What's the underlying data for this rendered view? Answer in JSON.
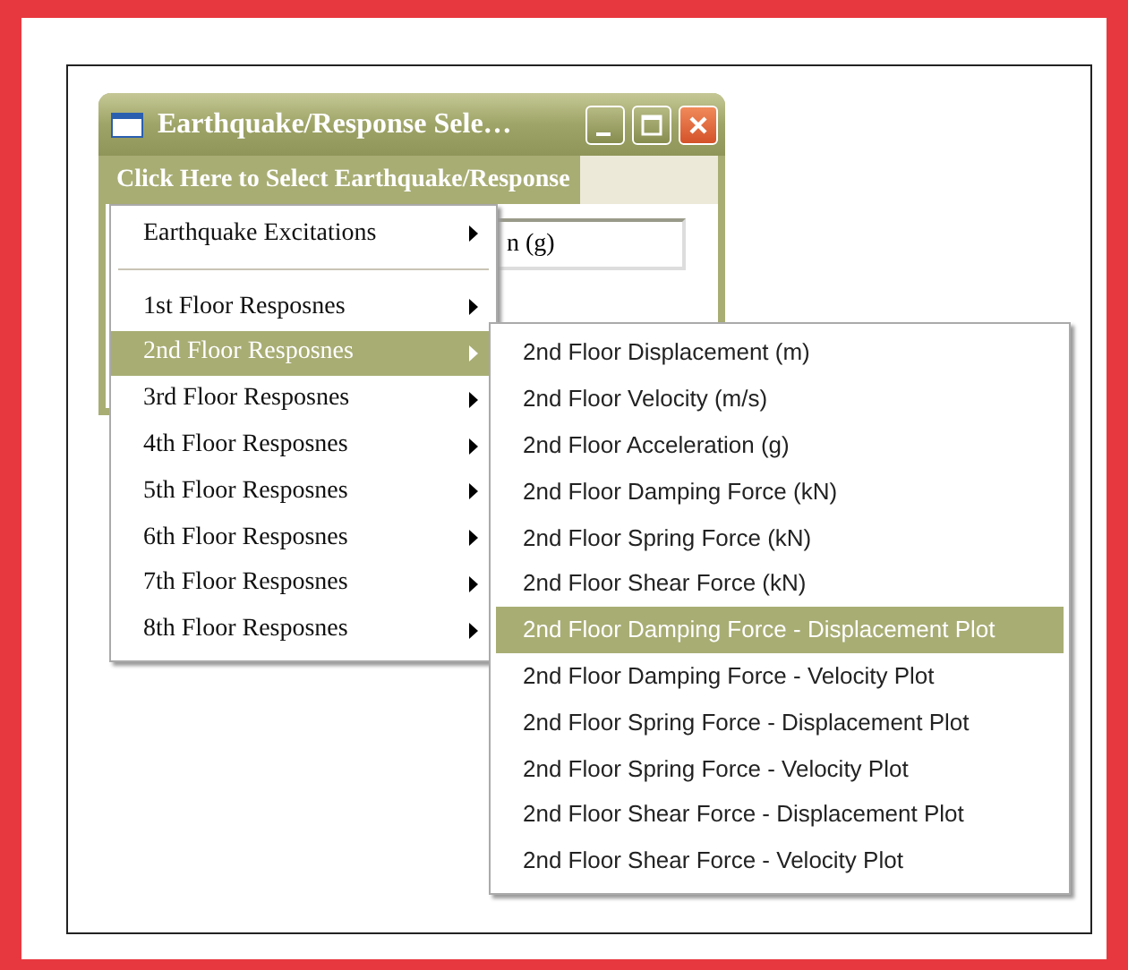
{
  "window": {
    "title": "Earthquake/Response Sele…",
    "menu_bar": "Click Here to Select Earthquake/Response",
    "field_value": "n (g)"
  },
  "menu": {
    "items": [
      {
        "kind": "item",
        "label": "Earthquake Excitations",
        "selected": false
      },
      {
        "kind": "separator"
      },
      {
        "kind": "item",
        "label": "1st Floor Resposnes",
        "selected": false
      },
      {
        "kind": "item",
        "label": "2nd Floor Resposnes",
        "selected": true
      },
      {
        "kind": "item",
        "label": "3rd Floor Resposnes",
        "selected": false
      },
      {
        "kind": "item",
        "label": "4th Floor Resposnes",
        "selected": false
      },
      {
        "kind": "item",
        "label": "5th Floor Resposnes",
        "selected": false
      },
      {
        "kind": "item",
        "label": "6th Floor Resposnes",
        "selected": false
      },
      {
        "kind": "item",
        "label": "7th Floor Resposnes",
        "selected": false
      },
      {
        "kind": "item",
        "label": "8th Floor Resposnes",
        "selected": false
      }
    ]
  },
  "submenu": {
    "items": [
      {
        "label": "2nd Floor Displacement (m)",
        "selected": false
      },
      {
        "label": "2nd Floor Velocity (m/s)",
        "selected": false
      },
      {
        "label": "2nd Floor Acceleration (g)",
        "selected": false
      },
      {
        "label": "2nd Floor Damping Force (kN)",
        "selected": false
      },
      {
        "label": "2nd Floor Spring Force (kN)",
        "selected": false
      },
      {
        "label": "2nd Floor Shear Force (kN)",
        "selected": false
      },
      {
        "label": "2nd Floor Damping Force - Displacement Plot",
        "selected": true
      },
      {
        "label": "2nd Floor Damping Force - Velocity Plot",
        "selected": false
      },
      {
        "label": "2nd Floor Spring Force - Displacement Plot",
        "selected": false
      },
      {
        "label": "2nd Floor Spring Force - Velocity Plot",
        "selected": false
      },
      {
        "label": "2nd Floor Shear Force - Displacement Plot",
        "selected": false
      },
      {
        "label": "2nd Floor Shear Force - Velocity Plot",
        "selected": false
      }
    ]
  }
}
